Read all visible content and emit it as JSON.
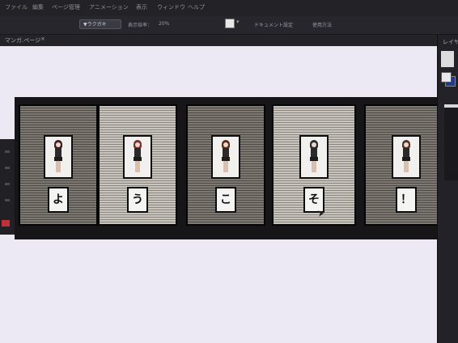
{
  "menubar": {
    "items": [
      "ファイル",
      "編集",
      "ページ管理",
      "アニメーション",
      "表示",
      "ウィンドウ",
      "ヘルプ"
    ]
  },
  "toolbar": {
    "tool_label": "▼ラクガキ",
    "zoom_label": "表示倍率：",
    "zoom_value": "20%",
    "doc_settings": "ドキュメント設定",
    "help_label": "使用方法"
  },
  "document": {
    "tab_label": "マンガ.ページ"
  },
  "panels": [
    {
      "char": "よ",
      "shade": "dark",
      "hair": "#3a2020"
    },
    {
      "char": "う",
      "shade": "light",
      "hair": "#7a3030"
    },
    {
      "char": "こ",
      "shade": "dark",
      "hair": "#5a2a20"
    },
    {
      "char": "そ",
      "shade": "light",
      "hair": "#2a2a30"
    },
    {
      "char": "！",
      "shade": "dark",
      "hair": "#4a3428"
    }
  ],
  "right_panel": {
    "label": "レイヤー"
  },
  "colors": {
    "canvas": "#ece8f4",
    "page": "#161618",
    "foreground": "#e8e8e8",
    "background": "#1a3a9a"
  }
}
